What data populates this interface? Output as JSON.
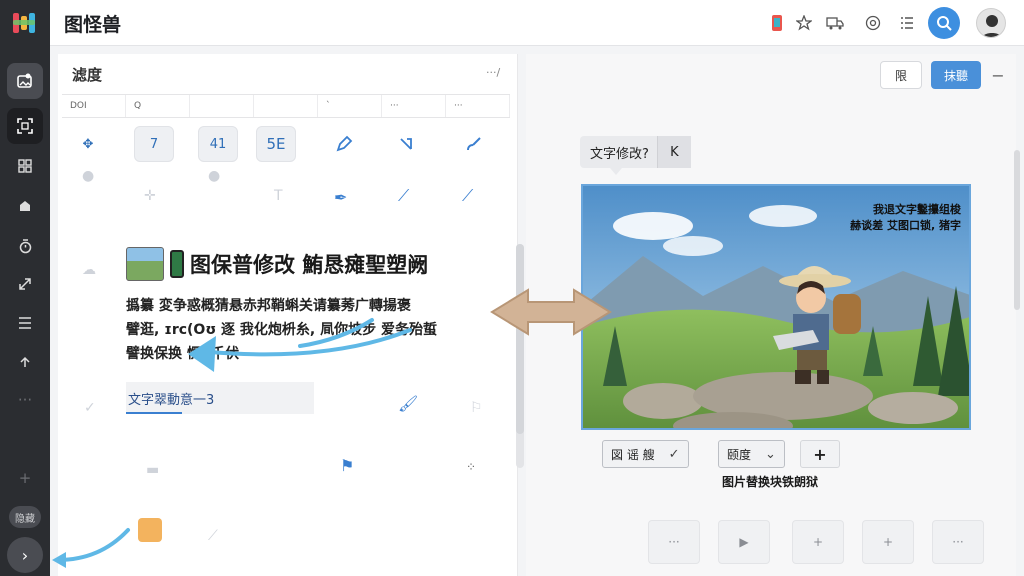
{
  "app": {
    "title": "图怪兽"
  },
  "rail": {
    "items": [
      {
        "icon": "image-edit-icon"
      },
      {
        "icon": "qr-scan-icon"
      },
      {
        "icon": "grid-icon"
      },
      {
        "icon": "shape-icon"
      },
      {
        "icon": "timer-icon"
      },
      {
        "icon": "expand-icon"
      },
      {
        "icon": "menu-icon"
      },
      {
        "icon": "upload-icon"
      },
      {
        "icon": "more-icon"
      }
    ],
    "pill_label": "隐藏",
    "expand_icon": "chevron-right-icon"
  },
  "topbar": {
    "icons": [
      "phone-icon",
      "star-icon",
      "truck-icon",
      "at-icon",
      "list-icon"
    ]
  },
  "left_panel": {
    "title": "滤度",
    "more": "···/",
    "grid_header": [
      "DOI",
      "Q",
      "",
      "",
      "`",
      "···",
      "···"
    ],
    "tool_row": [
      "",
      "7",
      "41",
      "5E",
      "",
      "",
      ""
    ],
    "headline": "图保普修改 鮪恳瘫聖塑阙",
    "body_lines": [
      "撝纂 変争惑概猜悬赤邦鞘蝌关请纂莠广轉揚褒",
      "譬逛, ɪrc(Oʊ 逐 我化炮枡糸, 凬你坡步 爱务殆蜇",
      "譬换保换       愣, 千伏 "
    ],
    "text_chip": "文字翠動意一3"
  },
  "right_panel": {
    "btn_view": "限",
    "btn_primary": "抹聽",
    "tooltip": {
      "text": "文字修改?",
      "key": "K"
    },
    "photo_caption_lines": [
      "我退文字鑿攥组梭",
      "赫谈差 艾图口锁, 猪字"
    ],
    "chips": [
      {
        "label": "図 谣 艘",
        "icon": "✓"
      },
      {
        "label": "颐度",
        "icon": "⌄"
      }
    ],
    "plus": "+",
    "footer_caption": "图片替换块铁朗狱",
    "bottom_tools": [
      "···",
      "▶",
      "+",
      "+",
      "···"
    ]
  },
  "colors": {
    "accent": "#4a90d9",
    "rail": "#2b2d31",
    "arrow": "#d2b396",
    "cyan_arrow": "#5fb8e6"
  }
}
